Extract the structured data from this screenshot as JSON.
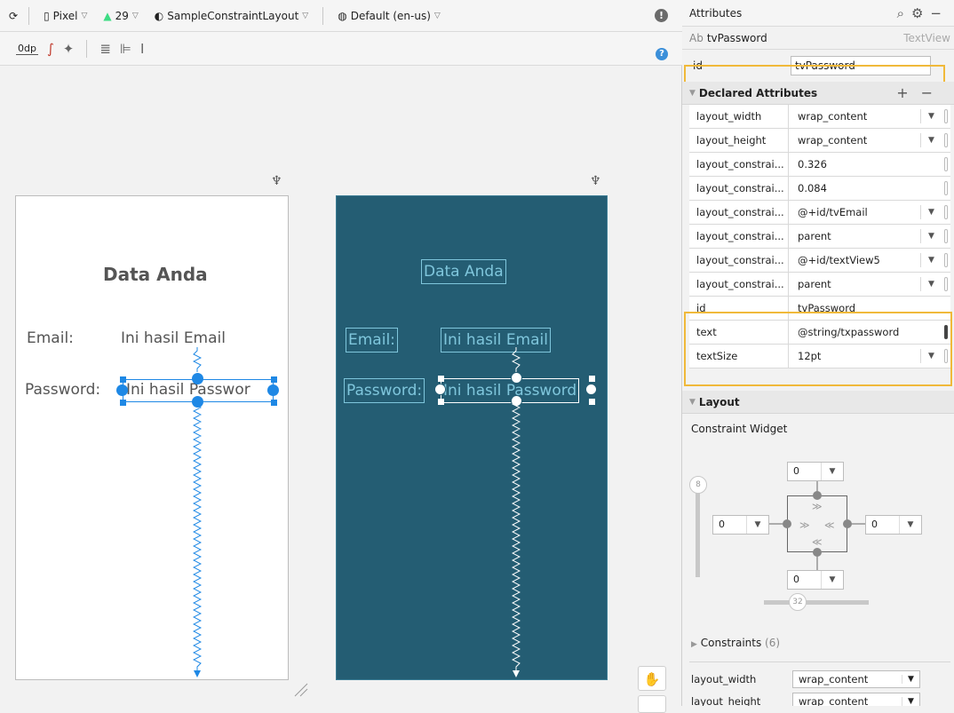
{
  "toolbar": {
    "device": "Pixel",
    "api_level": "29",
    "theme": "SampleConstraintLayout",
    "locale": "Default (en-us)",
    "default_margin": "0dp"
  },
  "design": {
    "title": "Data Anda",
    "email_label": "Email:",
    "email_value": "Ini hasil Email",
    "password_label": "Password:",
    "password_value": "Ini hasil Passwor"
  },
  "blueprint": {
    "title": "Data Anda",
    "email_label": "Email:",
    "email_value": "Ini hasil Email",
    "password_label": "Password:",
    "password_value": "Ini hasil Password"
  },
  "attributes": {
    "header": "Attributes",
    "component_prefix": "Ab",
    "component_name": "tvPassword",
    "component_type": "TextView",
    "id_label": "id",
    "id_value": "tvPassword",
    "declared_title": "Declared Attributes",
    "declared": [
      {
        "key": "layout_width",
        "value": "wrap_content"
      },
      {
        "key": "layout_height",
        "value": "wrap_content"
      },
      {
        "key": "layout_constrai...",
        "value": "0.326"
      },
      {
        "key": "layout_constrai...",
        "value": "0.084"
      },
      {
        "key": "layout_constrai...",
        "value": "@+id/tvEmail"
      },
      {
        "key": "layout_constrai...",
        "value": "parent"
      },
      {
        "key": "layout_constrai...",
        "value": "@+id/textView5"
      },
      {
        "key": "layout_constrai...",
        "value": "parent"
      },
      {
        "key": "id",
        "value": "tvPassword"
      },
      {
        "key": "text",
        "value": "@string/txpassword"
      },
      {
        "key": "textSize",
        "value": "12pt"
      }
    ],
    "layout_title": "Layout",
    "constraint_widget_title": "Constraint Widget",
    "margins": {
      "top": "0",
      "left": "0",
      "right": "0",
      "bottom": "0"
    },
    "bias_vertical": "8",
    "bias_horizontal": "32",
    "constraints_label": "Constraints",
    "constraints_count": "(6)",
    "bottom_rows": [
      {
        "key": "layout_width",
        "value": "wrap_content"
      },
      {
        "key": "layout_height",
        "value": "wrap_content"
      }
    ]
  }
}
